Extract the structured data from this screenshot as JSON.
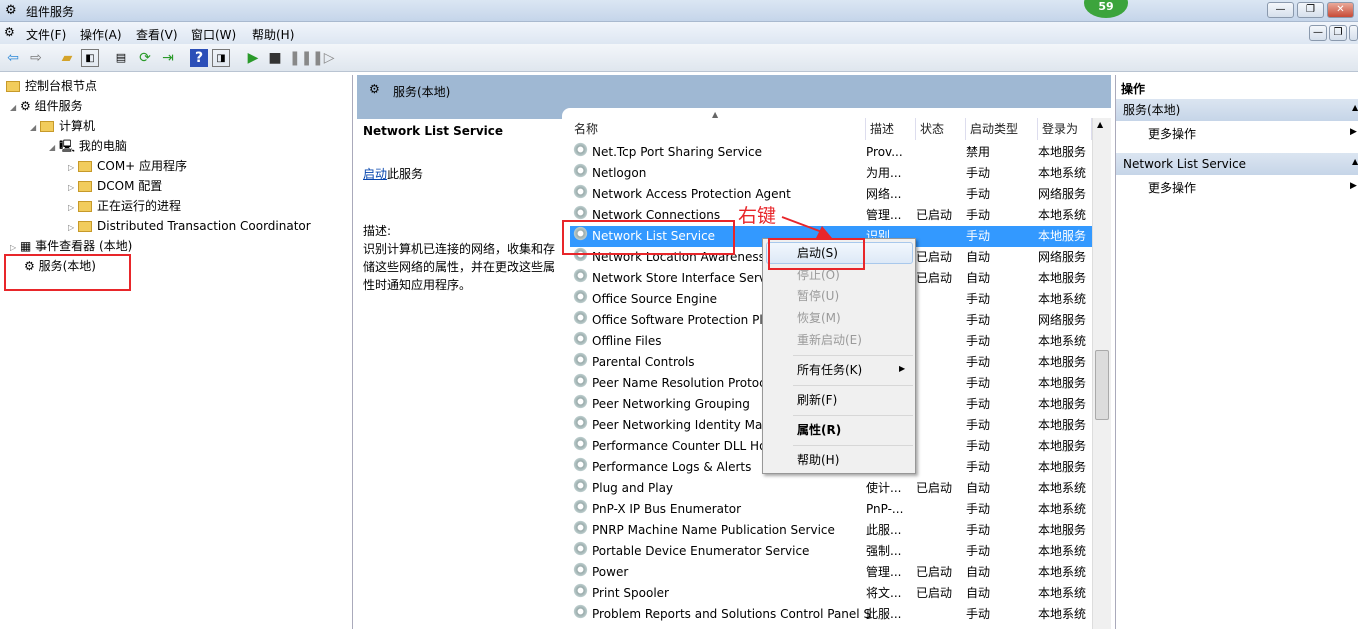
{
  "window": {
    "title": "组件服务",
    "badge": "59"
  },
  "menu": [
    "文件(F)",
    "操作(A)",
    "查看(V)",
    "窗口(W)",
    "帮助(H)"
  ],
  "toolbar": [
    "back-icon",
    "forward-icon",
    "up-folder-icon",
    "show-hide-tree-icon",
    "properties-icon",
    "refresh-icon",
    "export-icon",
    "help-icon",
    "show-hide-action-icon",
    "play-icon",
    "stop-icon",
    "pause-icon",
    "resume-icon"
  ],
  "tree": {
    "root": "控制台根节点",
    "component_services": "组件服务",
    "computers": "计算机",
    "my_computer": "我的电脑",
    "children": [
      "COM+ 应用程序",
      "DCOM 配置",
      "正在运行的进程",
      "Distributed Transaction Coordinator"
    ],
    "event_viewer": "事件查看器 (本地)",
    "services": "服务(本地)"
  },
  "middle": {
    "header": "服务(本地)",
    "selected_service": "Network List Service",
    "start_link": "启动",
    "start_suffix": "此服务",
    "desc_label": "描述:",
    "desc_text": "识别计算机已连接的网络，收集和存储这些网络的属性，并在更改这些属性时通知应用程序。"
  },
  "columns": [
    "名称",
    "描述",
    "状态",
    "启动类型",
    "登录为"
  ],
  "services": [
    [
      "Net.Tcp Port Sharing Service",
      "Prov...",
      "",
      "禁用",
      "本地服务"
    ],
    [
      "Netlogon",
      "为用...",
      "",
      "手动",
      "本地系统"
    ],
    [
      "Network Access Protection Agent",
      "网络...",
      "",
      "手动",
      "网络服务"
    ],
    [
      "Network Connections",
      "管理...",
      "已启动",
      "手动",
      "本地系统"
    ],
    [
      "Network List Service",
      "识别...",
      "",
      "手动",
      "本地服务"
    ],
    [
      "Network Location Awareness",
      "",
      "已启动",
      "自动",
      "网络服务"
    ],
    [
      "Network Store Interface Service",
      "",
      "已启动",
      "自动",
      "本地服务"
    ],
    [
      "Office  Source Engine",
      "",
      "",
      "手动",
      "本地系统"
    ],
    [
      "Office Software Protection Platform",
      "",
      "",
      "手动",
      "网络服务"
    ],
    [
      "Offline Files",
      "",
      "",
      "手动",
      "本地系统"
    ],
    [
      "Parental Controls",
      "",
      "",
      "手动",
      "本地服务"
    ],
    [
      "Peer Name Resolution Protocol",
      "",
      "",
      "手动",
      "本地服务"
    ],
    [
      "Peer Networking Grouping",
      "",
      "",
      "手动",
      "本地服务"
    ],
    [
      "Peer Networking Identity Manager",
      "",
      "",
      "手动",
      "本地服务"
    ],
    [
      "Performance Counter DLL Host",
      "",
      "",
      "手动",
      "本地服务"
    ],
    [
      "Performance Logs & Alerts",
      "",
      "",
      "手动",
      "本地服务"
    ],
    [
      "Plug and Play",
      "使计...",
      "已启动",
      "自动",
      "本地系统"
    ],
    [
      "PnP-X IP Bus Enumerator",
      "PnP-...",
      "",
      "手动",
      "本地系统"
    ],
    [
      "PNRP Machine Name Publication Service",
      "此服...",
      "",
      "手动",
      "本地服务"
    ],
    [
      "Portable Device Enumerator Service",
      "强制...",
      "",
      "手动",
      "本地系统"
    ],
    [
      "Power",
      "管理...",
      "已启动",
      "自动",
      "本地系统"
    ],
    [
      "Print Spooler",
      "将文...",
      "已启动",
      "自动",
      "本地系统"
    ],
    [
      "Problem Reports and Solutions Control Panel Support",
      "此服...",
      "",
      "手动",
      "本地系统"
    ]
  ],
  "actions": {
    "title": "操作",
    "section1": "服务(本地)",
    "more1": "更多操作",
    "section2": "Network List Service",
    "more2": "更多操作"
  },
  "context_menu": {
    "start": "启动(S)",
    "stop": "停止(O)",
    "pause": "暂停(U)",
    "resume": "恢复(M)",
    "restart": "重新启动(E)",
    "all_tasks": "所有任务(K)",
    "refresh": "刷新(F)",
    "properties": "属性(R)",
    "help": "帮助(H)"
  },
  "annotation": "右键",
  "colors": {
    "selection": "#3399ff",
    "highlight_box": "#e8262a",
    "annotation": "#e8262a"
  }
}
